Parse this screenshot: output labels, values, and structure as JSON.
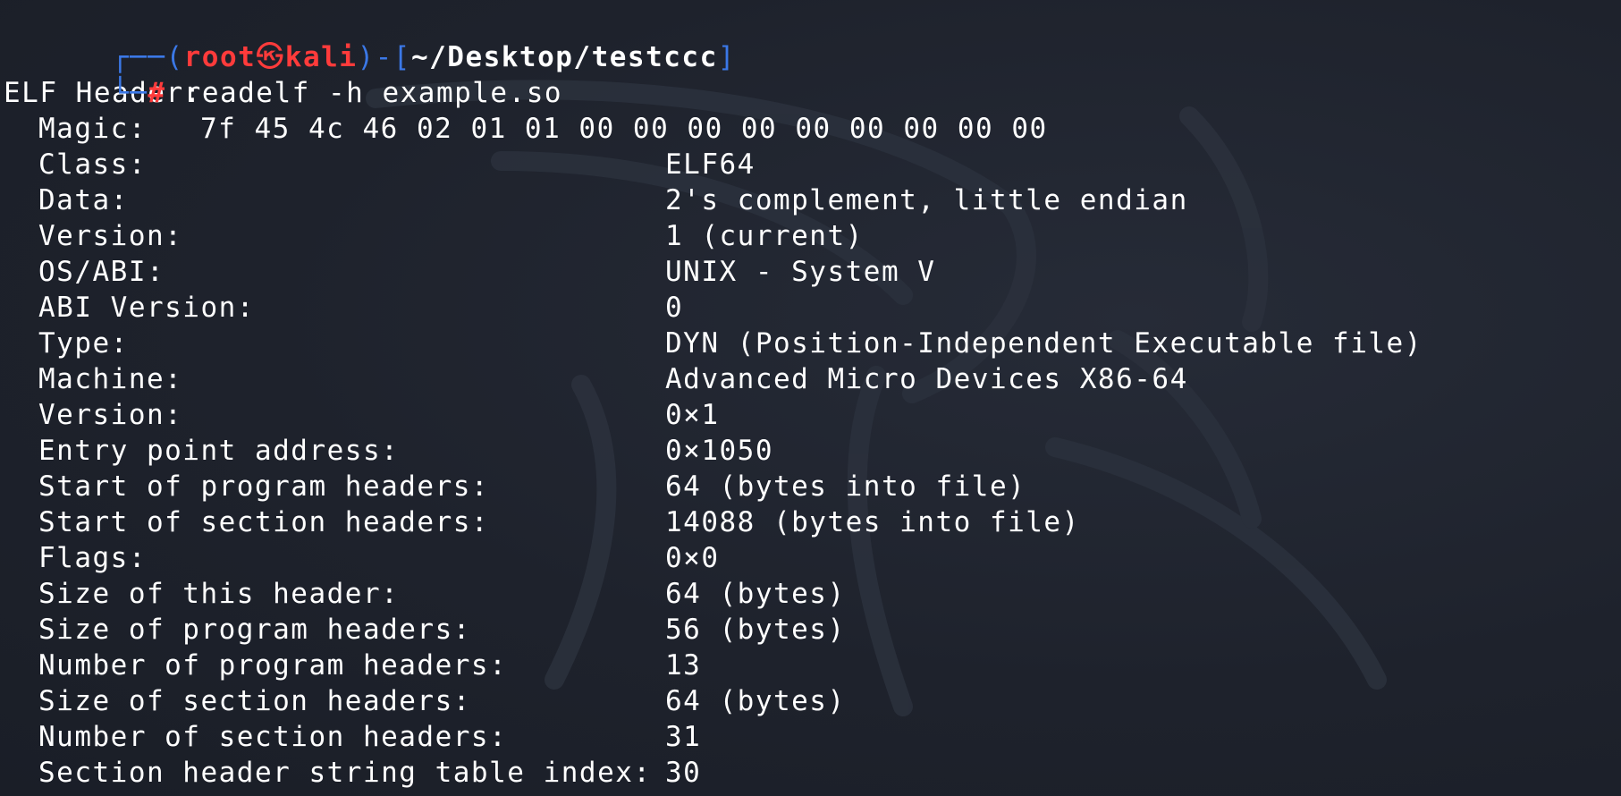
{
  "prompt": {
    "user": "root",
    "skull_icon": "kali-skull-icon",
    "host": "kali",
    "path": "~/Desktop/testccc",
    "symbol": "#",
    "command": "readelf -h example.so"
  },
  "header_title": "ELF Header:",
  "magic": {
    "label": "Magic:",
    "value": "7f 45 4c 46 02 01 01 00 00 00 00 00 00 00 00 00"
  },
  "fields": [
    {
      "key": "Class:",
      "value": "ELF64"
    },
    {
      "key": "Data:",
      "value": "2's complement, little endian"
    },
    {
      "key": "Version:",
      "value": "1 (current)"
    },
    {
      "key": "OS/ABI:",
      "value": "UNIX - System V"
    },
    {
      "key": "ABI Version:",
      "value": "0"
    },
    {
      "key": "Type:",
      "value": "DYN (Position-Independent Executable file)"
    },
    {
      "key": "Machine:",
      "value": "Advanced Micro Devices X86-64"
    },
    {
      "key": "Version:",
      "value": "0×1"
    },
    {
      "key": "Entry point address:",
      "value": "0×1050"
    },
    {
      "key": "Start of program headers:",
      "value": "64 (bytes into file)"
    },
    {
      "key": "Start of section headers:",
      "value": "14088 (bytes into file)"
    },
    {
      "key": "Flags:",
      "value": "0×0"
    },
    {
      "key": "Size of this header:",
      "value": "64 (bytes)"
    },
    {
      "key": "Size of program headers:",
      "value": "56 (bytes)"
    },
    {
      "key": "Number of program headers:",
      "value": "13"
    },
    {
      "key": "Size of section headers:",
      "value": "64 (bytes)"
    },
    {
      "key": "Number of section headers:",
      "value": "31"
    },
    {
      "key": "Section header string table index:",
      "value": "30"
    }
  ],
  "colors": {
    "background": "#1f2430",
    "prompt_tree": "#3b78e7",
    "prompt_user": "#ff3b3b",
    "text": "#ffffff"
  }
}
